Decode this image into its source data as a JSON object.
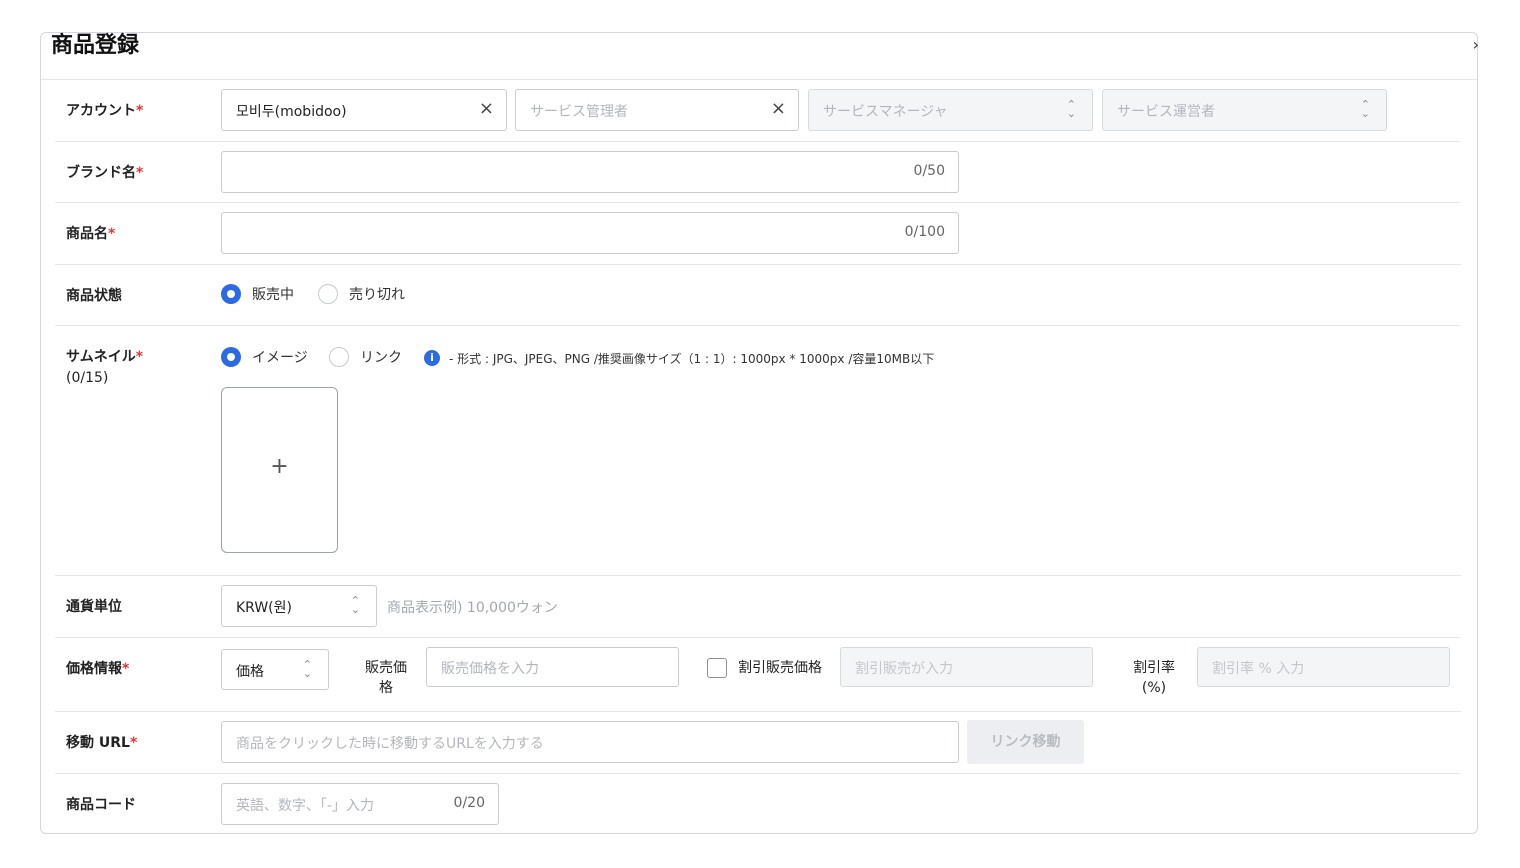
{
  "panel": {
    "title": "商品登録",
    "chevron": "›"
  },
  "account": {
    "label": "アカウント",
    "required": "*",
    "selected_value": "모비두(mobidoo)",
    "admin_placeholder": "サービス管理者",
    "manager_placeholder": "サービスマネージャ",
    "operator_placeholder": "サービス運営者",
    "clear_icon": "×",
    "updown_icon": "⌃⌄"
  },
  "brand": {
    "label": "ブランド名",
    "required": "*",
    "counter": "0/50"
  },
  "product_name": {
    "label": "商品名",
    "required": "*",
    "counter": "0/100"
  },
  "status": {
    "label": "商品状態",
    "options": [
      {
        "label": "販売中",
        "selected": true
      },
      {
        "label": "売り切れ",
        "selected": false
      }
    ]
  },
  "thumbnail": {
    "label": "サムネイル",
    "required": "*",
    "count": "(0/15)",
    "options": [
      {
        "label": "イメージ",
        "selected": true
      },
      {
        "label": "リンク",
        "selected": false
      }
    ],
    "info_icon": "i",
    "info_text": "- 形式 : JPG、JPEG、PNG /推奨画像サイズ（1 : 1）: 1000px * 1000px /容量10MB以下",
    "add_symbol": "+"
  },
  "currency": {
    "label": "通貨単位",
    "value": "KRW(원)",
    "example": "商品表示例) 10,000ウォン"
  },
  "price": {
    "label": "価格情報",
    "required": "*",
    "type_value": "価格",
    "sale_price_label": "販売価格",
    "sale_price_placeholder": "販売価格を入力",
    "discount_check_label": "割引販売価格",
    "discount_price_placeholder": "割引販売が入力",
    "discount_rate_label": "割引率(%)",
    "discount_rate_placeholder": "割引率 % 入力"
  },
  "url": {
    "label": "移動 URL",
    "required": "*",
    "placeholder": "商品をクリックした時に移動するURLを入力する",
    "button_label": "リンク移動"
  },
  "code": {
    "label": "商品コード",
    "placeholder": "英語、数字、「-」入力",
    "counter": "0/20"
  },
  "colors": {
    "accent": "#2d6be4",
    "required": "#e0363a",
    "border": "#c9ccd2",
    "disabled_bg": "#f4f5f7"
  }
}
